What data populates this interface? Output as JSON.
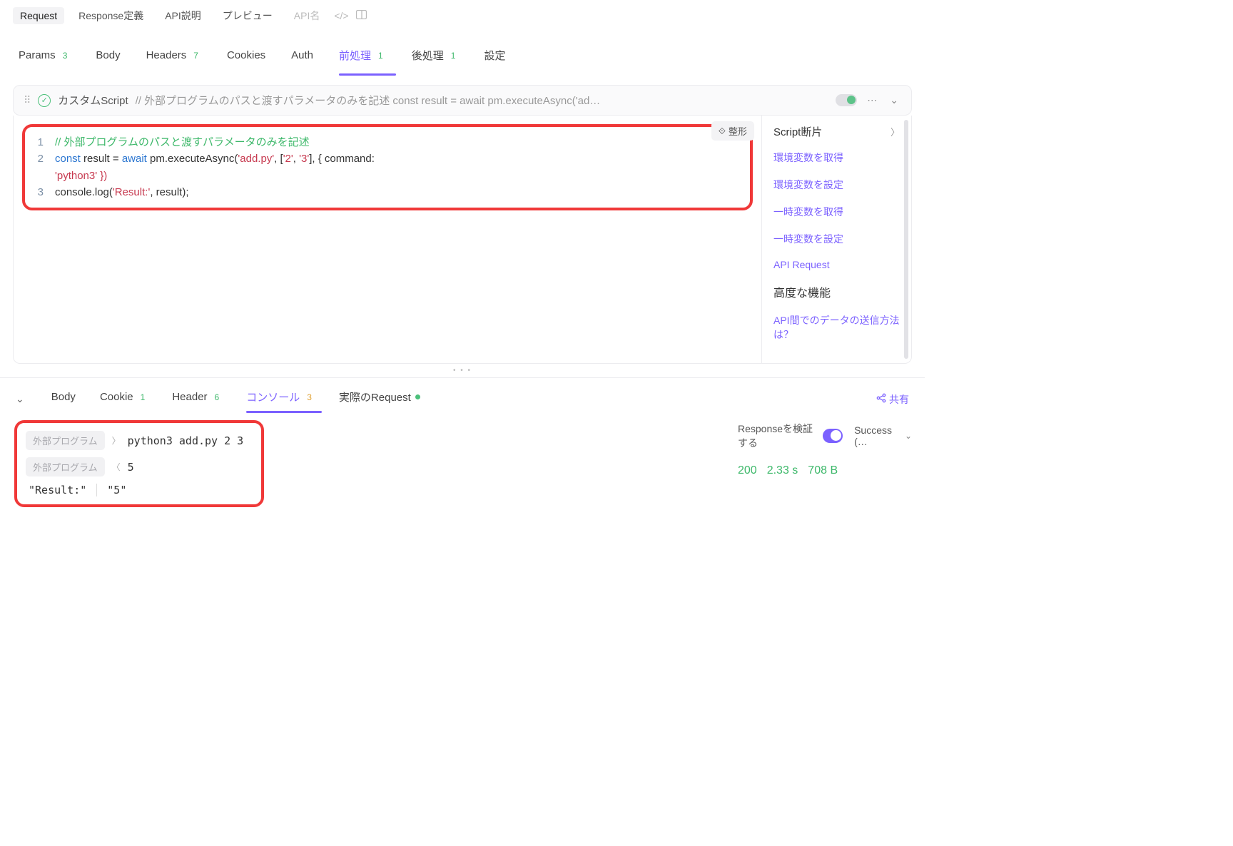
{
  "topTabs": {
    "request": "Request",
    "responseDef": "Response定義",
    "apiDesc": "API説明",
    "preview": "プレビュー",
    "apiNamePh": "API名"
  },
  "subTabs": {
    "params": "Params",
    "paramsBadge": "3",
    "body": "Body",
    "headers": "Headers",
    "headersBadge": "7",
    "cookies": "Cookies",
    "auth": "Auth",
    "pre": "前処理",
    "preBadge": "1",
    "post": "後処理",
    "postBadge": "1",
    "settings": "設定"
  },
  "card": {
    "title": "カスタムScript",
    "comment": "// 外部プログラムのパスと渡すパラメータのみを記述 const result = await pm.executeAsync('ad…"
  },
  "formatBtn": "整形",
  "code": {
    "l1_comment": "// 外部プログラムのパスと渡すパラメータのみを記述",
    "l2a": "const",
    "l2b": " result = ",
    "l2c": "await",
    "l2d": " pm.executeAsync(",
    "l2e": "'add.py'",
    "l2f": ", [",
    "l2g": "'2'",
    "l2h": ", ",
    "l2i": "'3'",
    "l2j": "], { command:",
    "l2k": "'python3'",
    "l2l": " })",
    "l3a": "console.log(",
    "l3b": "'Result:'",
    "l3c": ", result);"
  },
  "aside": {
    "title": "Script断片",
    "items": [
      "環境変数を取得",
      "環境変数を設定",
      "一時変数を取得",
      "一時変数を設定",
      "API Request"
    ],
    "advanced": "高度な機能",
    "apiSend": "API間でのデータの送信方法は？"
  },
  "bottomTabs": {
    "body": "Body",
    "cookie": "Cookie",
    "cookieBadge": "1",
    "header": "Header",
    "headerBadge": "6",
    "console": "コンソール",
    "consoleBadge": "3",
    "actual": "実際のRequest",
    "share": "共有"
  },
  "console": {
    "program": "外部プログラム",
    "cmd": "python3 add.py 2 3",
    "out": "5",
    "resLabel": "\"Result:\"",
    "resVal": "\"5\""
  },
  "status": {
    "verify": "Responseを検証する",
    "success": "Success (…",
    "code": "200",
    "time": "2.33 s",
    "size": "708 B"
  }
}
